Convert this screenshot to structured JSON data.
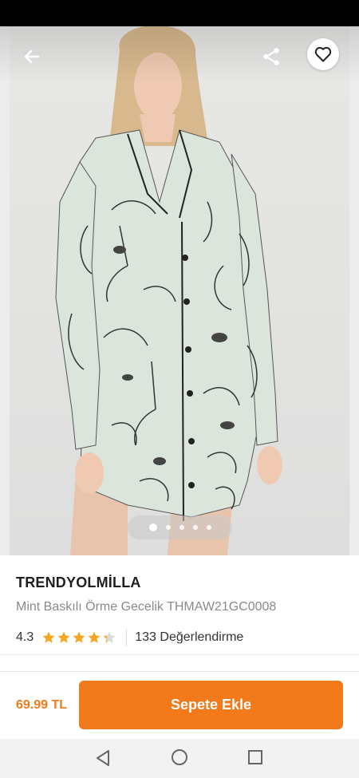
{
  "product": {
    "brand": "TRENDYOLMİLLA",
    "name": "Mint Baskılı Örme Gecelik THMAW21GC0008",
    "rating": "4.3",
    "rating_value": 4.3,
    "reviews": "133 Değerlendirme"
  },
  "gallery": {
    "image_count": 5,
    "active_index": 0
  },
  "header_icons": {
    "back": "arrow-left-icon",
    "share": "share-icon",
    "favorite": "heart-icon"
  },
  "purchase": {
    "price": "69.99 TL",
    "cart_label": "Sepete Ekle"
  },
  "colors": {
    "accent": "#f27a1a",
    "star": "#f5a623",
    "brand_text": "#1f1f1f",
    "muted_text": "#8a8a8a"
  },
  "system_nav": {
    "back": "nav-back-icon",
    "home": "nav-home-icon",
    "recents": "nav-recents-icon"
  }
}
